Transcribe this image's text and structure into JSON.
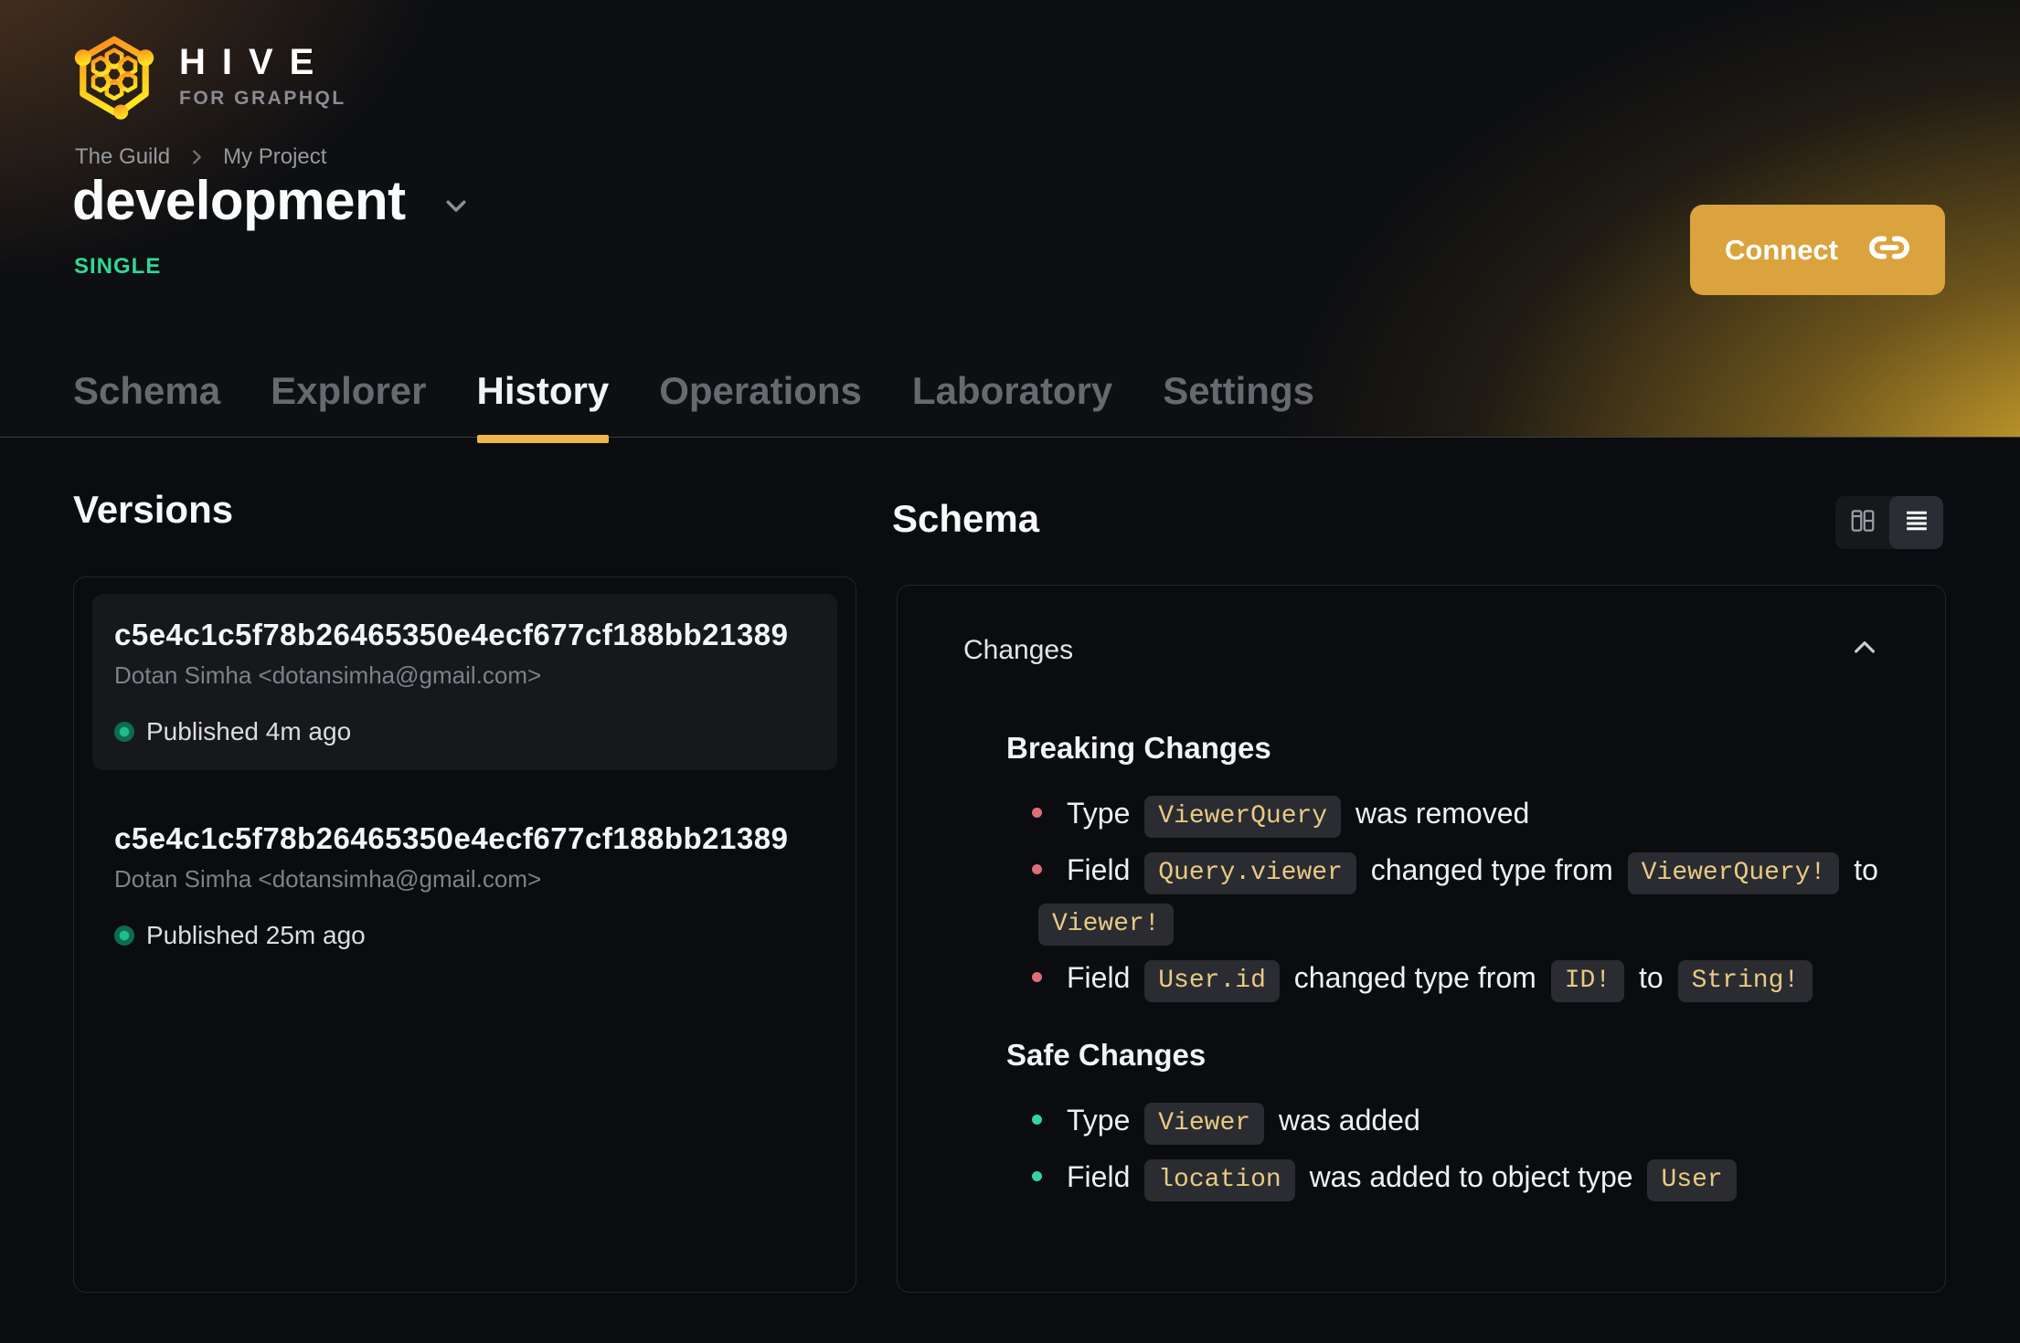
{
  "brand": {
    "name": "HIVE",
    "tagline": "FOR GRAPHQL"
  },
  "breadcrumb": {
    "org": "The Guild",
    "project": "My Project"
  },
  "target": {
    "name": "development",
    "badge": "SINGLE"
  },
  "connect": {
    "label": "Connect"
  },
  "tabs": [
    {
      "label": "Schema",
      "active": false
    },
    {
      "label": "Explorer",
      "active": false
    },
    {
      "label": "History",
      "active": true
    },
    {
      "label": "Operations",
      "active": false
    },
    {
      "label": "Laboratory",
      "active": false
    },
    {
      "label": "Settings",
      "active": false
    }
  ],
  "versions": {
    "heading": "Versions",
    "items": [
      {
        "hash": "c5e4c1c5f78b26465350e4ecf677cf188bb21389",
        "author": "Dotan Simha <dotansimha@gmail.com>",
        "status": "Published 4m ago",
        "selected": true
      },
      {
        "hash": "c5e4c1c5f78b26465350e4ecf677cf188bb21389",
        "author": "Dotan Simha <dotansimha@gmail.com>",
        "status": "Published 25m ago",
        "selected": false
      }
    ]
  },
  "schema": {
    "heading": "Schema",
    "changes_label": "Changes",
    "view_modes": [
      "columns-icon",
      "list-icon"
    ],
    "active_view": "list-icon",
    "sections": [
      {
        "title": "Breaking Changes",
        "kind": "breaking",
        "items": [
          [
            {
              "text": "Type "
            },
            {
              "code": "ViewerQuery"
            },
            {
              "text": " was removed"
            }
          ],
          [
            {
              "text": "Field "
            },
            {
              "code": "Query.viewer"
            },
            {
              "text": " changed type from "
            },
            {
              "code": "ViewerQuery!"
            },
            {
              "text": " to "
            },
            {
              "code": "Viewer!"
            }
          ],
          [
            {
              "text": "Field "
            },
            {
              "code": "User.id"
            },
            {
              "text": " changed type from "
            },
            {
              "code": "ID!"
            },
            {
              "text": " to "
            },
            {
              "code": "String!"
            }
          ]
        ]
      },
      {
        "title": "Safe Changes",
        "kind": "safe",
        "items": [
          [
            {
              "text": "Type "
            },
            {
              "code": "Viewer"
            },
            {
              "text": " was added"
            }
          ],
          [
            {
              "text": "Field "
            },
            {
              "code": "location"
            },
            {
              "text": " was added to object type "
            },
            {
              "code": "User"
            }
          ]
        ]
      }
    ]
  },
  "icons": {
    "connect": "link-icon",
    "title_dropdown": "chevron-down-icon",
    "breadcrumb_separator": "chevron-right-icon",
    "changes_collapse": "chevron-up-icon",
    "published_status": "green-dot-icon"
  },
  "colors": {
    "background": "#0a0c0f",
    "accent": "#efb64a",
    "connect_button": "#daa33d",
    "badge_green": "#2ed996",
    "breaking_bullet": "#df6e78",
    "safe_bullet": "#35d49c",
    "chip_text": "#e9ca82"
  }
}
